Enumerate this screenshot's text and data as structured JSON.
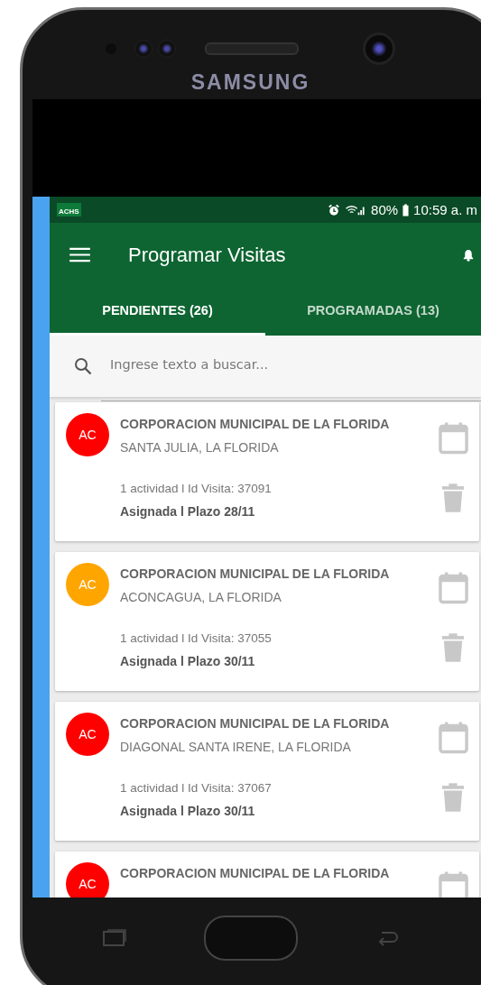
{
  "device": {
    "brand": "SAMSUNG"
  },
  "status_bar": {
    "app_badge": "ACHS",
    "battery": "80%",
    "time": "10:59 a. m"
  },
  "toolbar": {
    "title": "Programar Visitas"
  },
  "tabs": [
    {
      "label": "PENDIENTES (26)",
      "selected": true
    },
    {
      "label": "PROGRAMADAS (13)",
      "selected": false
    }
  ],
  "search": {
    "placeholder": "Ingrese texto a buscar..."
  },
  "visits": [
    {
      "initials": "AC",
      "color": "#ff0000",
      "title": "CORPORACION MUNICIPAL DE LA FLORIDA",
      "address": "SANTA JULIA, LA FLORIDA",
      "meta": "1 actividad l Id Visita: 37091",
      "status": "Asignada l Plazo 28/11"
    },
    {
      "initials": "AC",
      "color": "#ffa500",
      "title": "CORPORACION MUNICIPAL DE LA FLORIDA",
      "address": "ACONCAGUA, LA FLORIDA",
      "meta": "1 actividad l Id Visita: 37055",
      "status": "Asignada l Plazo 30/11"
    },
    {
      "initials": "AC",
      "color": "#ff0000",
      "title": "CORPORACION MUNICIPAL DE LA FLORIDA",
      "address": "DIAGONAL SANTA IRENE, LA FLORIDA",
      "meta": "1 actividad l Id Visita: 37067",
      "status": "Asignada l Plazo 30/11"
    },
    {
      "initials": "AC",
      "color": "#ff0000",
      "title": "CORPORACION MUNICIPAL DE LA FLORIDA"
    }
  ]
}
